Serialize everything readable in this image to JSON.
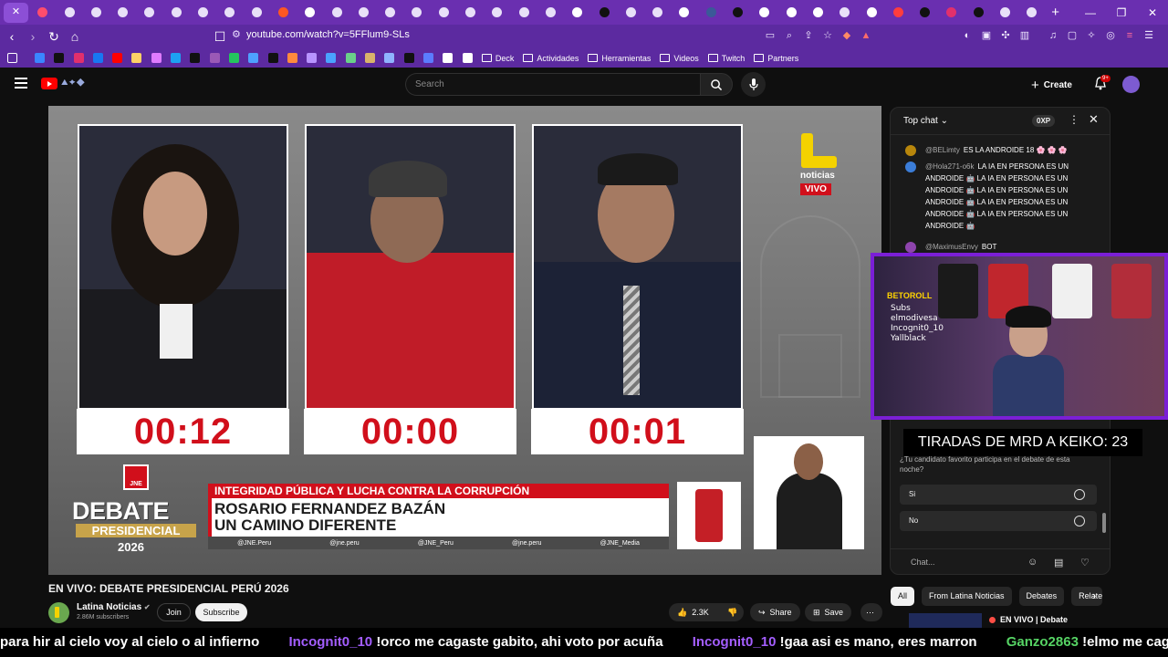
{
  "browser": {
    "tab_count": 39,
    "active_tab_close": "✕",
    "new_tab": "+",
    "url": "youtube.com/watch?v=5FFlum9-SLs",
    "bookmark_folders": [
      "Deck",
      "Actividades",
      "Herramientas",
      "Videos",
      "Twitch",
      "Partners"
    ]
  },
  "youtube": {
    "search_placeholder": "Search",
    "create_label": "Create",
    "notif_badge": "9+"
  },
  "video": {
    "timers": [
      "00:12",
      "00:00",
      "00:01"
    ],
    "noticias": "noticias",
    "vivo": "VIVO",
    "debate": "DEBATE",
    "presidencial": "PRESIDENCIAL",
    "year": "2026",
    "jne": "JNE",
    "topic": "INTEGRIDAD PÚBLICA Y LUCHA CONTRA LA CORRUPCIÓN",
    "candidate_name": "ROSARIO FERNANDEZ BAZÁN",
    "candidate_slogan": "UN CAMINO DIFERENTE",
    "socials": [
      "@JNE.Peru",
      "@jne.peru",
      "@JNE_Peru",
      "@jne.peru",
      "@JNE_Media"
    ],
    "title": "EN VIVO: DEBATE PRESIDENCIAL PERÚ 2026"
  },
  "channel": {
    "name": "Latina Noticias",
    "subscribers": "2.86M subscribers",
    "join": "Join",
    "subscribe": "Subscribe"
  },
  "actions": {
    "likes": "2.3K",
    "share": "Share",
    "save": "Save"
  },
  "chat": {
    "title": "Top chat",
    "xp": "0XP",
    "messages": [
      {
        "author": "@BELimty",
        "text": "ES LA ANDROIDE 18 🌸 🌸 🌸",
        "color": "#b8860b"
      },
      {
        "author": "@Hola271-o6k",
        "text": "LA IA EN PERSONA ES UN ANDROIDE 🤖 LA IA EN PERSONA ES UN ANDROIDE 🤖 LA IA EN PERSONA ES UN ANDROIDE 🤖 LA IA EN PERSONA ES UN ANDROIDE 🤖 LA IA EN PERSONA ES UN ANDROIDE 🤖",
        "color": "#3b7dd8"
      },
      {
        "author": "@MaximusEnvy",
        "text": "BOT",
        "color": "#8e44ad"
      }
    ],
    "poll_question": "¿Tu candidato favorito participa en el debate de esta noche?",
    "poll_options": [
      "Si",
      "No"
    ],
    "input_placeholder": "Chat..."
  },
  "overlay": {
    "tiradas": "TIRADAS DE MRD A KEIKO: 23",
    "brand": "BETOROLL",
    "webcam_chat": [
      "Subs",
      "elmodivesa",
      "Incognit0_10",
      "Yallblack"
    ]
  },
  "filters": [
    "All",
    "From Latina Noticias",
    "Debates",
    "Relate"
  ],
  "recommendation": {
    "title": "EN VIVO | Debate"
  },
  "ticker": [
    {
      "user": "",
      "text": "para hir al cielo voy al cielo o al infierno",
      "color": "#ffffff"
    },
    {
      "user": "Incognit0_10",
      "text": "!orco me cagaste gabito, ahi voto por acuña",
      "color": "#a45eff"
    },
    {
      "user": "Incognit0_10",
      "text": "!gaa asi es mano, eres marron",
      "color": "#a45eff"
    },
    {
      "user": "Ganzo2863",
      "text": "!elmo me cagastes",
      "color": "#56d364"
    }
  ]
}
